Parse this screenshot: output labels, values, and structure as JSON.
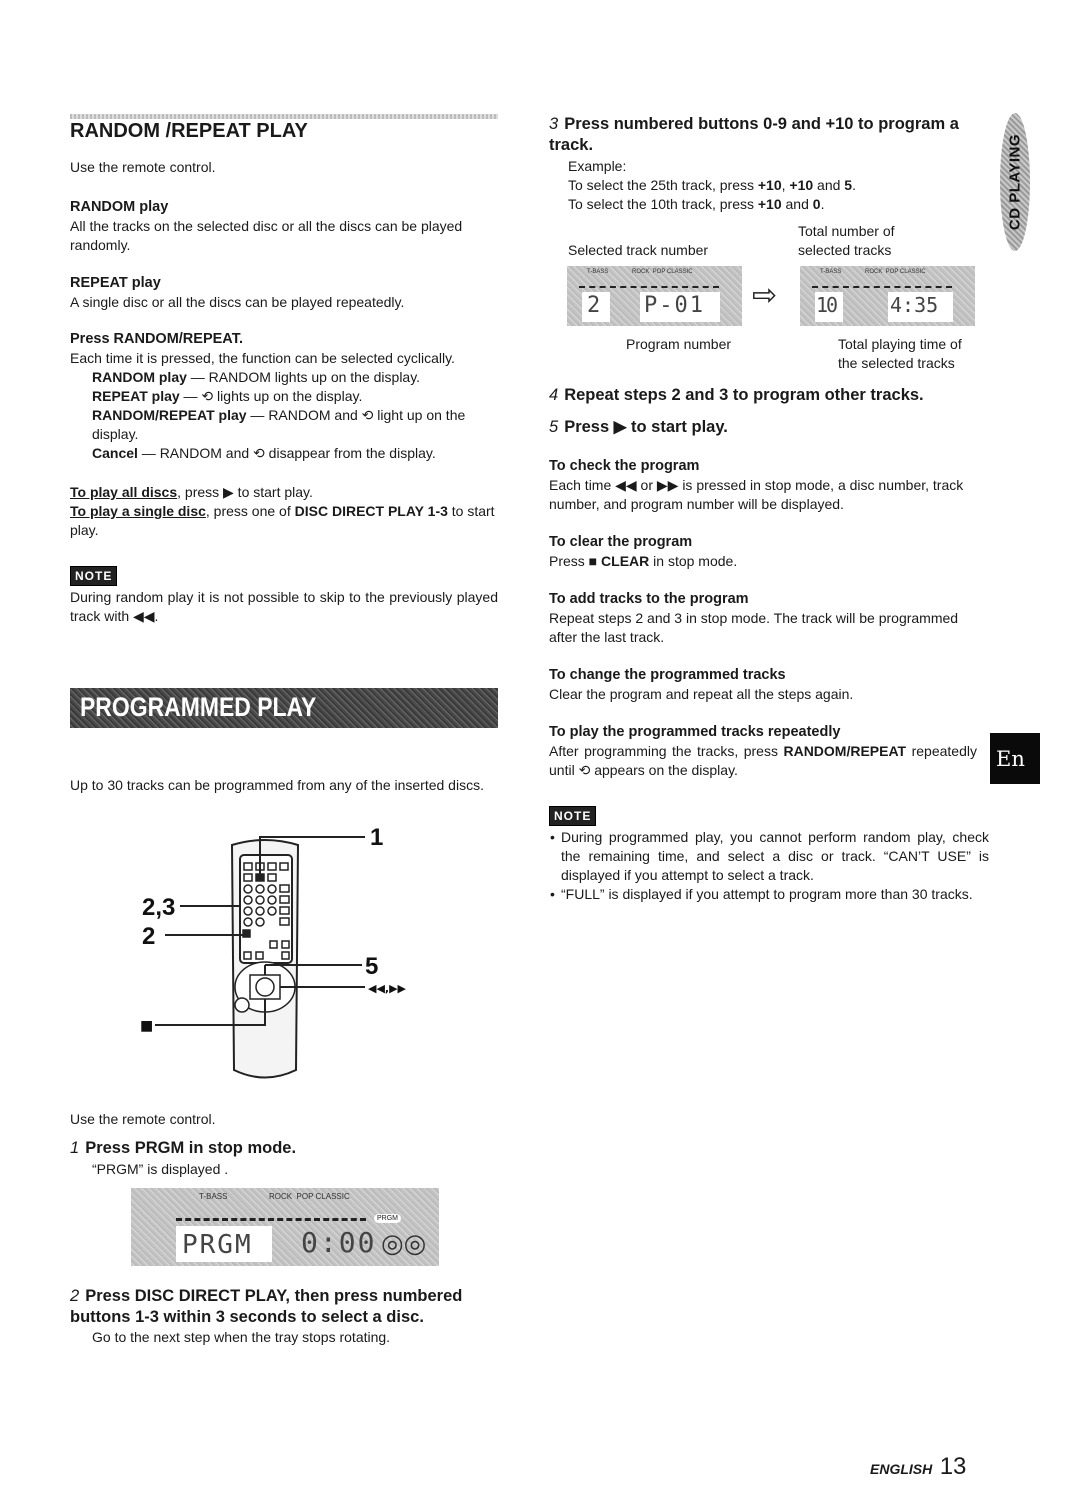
{
  "left": {
    "random_repeat": {
      "title": "RANDOM /REPEAT PLAY",
      "intro": "Use the remote control.",
      "random_heading": "RANDOM play",
      "random_text": "All the tracks on the selected disc or all the discs can be played randomly.",
      "repeat_heading": "REPEAT play",
      "repeat_text": "A single disc or all the discs can be played repeatedly.",
      "press_heading": "Press RANDOM/REPEAT.",
      "press_text": "Each time it is pressed, the function can be selected cyclically.",
      "modes": [
        {
          "label": "RANDOM play",
          "text": " — RANDOM lights up on the display."
        },
        {
          "label": "REPEAT play",
          "text": " — ⟲ lights up on the display."
        },
        {
          "label": "RANDOM/REPEAT play",
          "text": " — RANDOM and ⟲ light up on the display."
        },
        {
          "label": "Cancel",
          "text": " — RANDOM and ⟲ disappear from the display."
        }
      ],
      "all_discs_link": "To play all discs",
      "all_discs_text": ", press ▶ to start play.",
      "single_disc_link": "To play a single disc",
      "single_disc_text_a": ", press one of ",
      "single_disc_bold": "DISC DIRECT PLAY 1-3",
      "single_disc_text_b": " to start play.",
      "note_label": "NOTE",
      "note_text": "During random play it is not possible to skip to the previously played track with ◀◀."
    },
    "programmed": {
      "banner": "PROGRAMMED PLAY",
      "intro": "Up to 30 tracks can be programmed from any of the inserted discs.",
      "remote_labels": {
        "l1": "1",
        "l23": "2,3",
        "l2": "2",
        "l5": "5",
        "skip": "◀◀,▶▶",
        "stop": "■"
      },
      "use_remote": "Use the remote control.",
      "step1_num": "1",
      "step1_title": "Press PRGM in stop mode.",
      "step1_text": "“PRGM” is displayed .",
      "lcd1": {
        "tbass": "T-BASS",
        "modes": "ROCK  POP CLASSIC",
        "prgm_tag": "PRGM",
        "left": "PRGM",
        "right": "0:00"
      },
      "step2_num": "2",
      "step2_title": "Press DISC DIRECT PLAY, then press numbered buttons 1-3 within 3 seconds to select a disc.",
      "step2_text": "Go to the next step when the tray stops rotating."
    }
  },
  "right": {
    "step3_num": "3",
    "step3_title": "Press numbered buttons 0-9 and +10 to program a track.",
    "example_label": "Example:",
    "example1_a": "To select the 25th track, press ",
    "example1_b": "+10",
    "example1_c": ", ",
    "example1_d": "+10",
    "example1_e": " and ",
    "example1_f": "5",
    "example1_g": ".",
    "example2_a": "To select the 10th track, press ",
    "example2_b": "+10",
    "example2_c": " and ",
    "example2_d": "0",
    "example2_e": ".",
    "cap_selected_track": "Selected track number",
    "cap_total_number": "Total number of selected tracks",
    "cap_program_number": "Program number",
    "cap_total_time": "Total playing time of the selected tracks",
    "lcd2": {
      "tbass": "T-BASS",
      "modes": "ROCK  POP CLASSIC",
      "left": "2",
      "right": "P-01"
    },
    "lcd3": {
      "tbass": "T-BASS",
      "modes": "ROCK  POP CLASSIC",
      "left": "10",
      "right": "4:35"
    },
    "step4_num": "4",
    "step4_title": "Repeat steps 2 and 3 to program other tracks.",
    "step5_num": "5",
    "step5_title": "Press ▶ to start play.",
    "check_heading": "To check the program",
    "check_text": "Each time ◀◀ or ▶▶ is pressed in stop mode, a disc number, track number, and program number will be displayed.",
    "clear_heading": "To clear the program",
    "clear_text_a": "Press ■ ",
    "clear_text_b": "CLEAR",
    "clear_text_c": " in stop mode.",
    "add_heading": "To add tracks to the program",
    "add_text": "Repeat steps 2 and 3 in stop mode. The track will be programmed after the last track.",
    "change_heading": "To change the programmed tracks",
    "change_text": "Clear the program and repeat all the steps again.",
    "repeat_heading": "To play the programmed tracks repeatedly",
    "repeat_text_a": "After programming the tracks, press ",
    "repeat_text_b": "RANDOM/REPEAT",
    "repeat_text_c": " repeatedly until ⟲ appears on the display.",
    "note_label": "NOTE",
    "notes": [
      "During programmed play, you cannot perform random play, check the remaining time, and select a disc or track. “CAN’T USE” is displayed if you attempt to select a track.",
      "“FULL” is displayed if you attempt to program more than 30 tracks."
    ]
  },
  "side_tab": "CD PLAYING",
  "lang_tab": "En",
  "footer": {
    "lang": "ENGLISH",
    "page": "13"
  }
}
